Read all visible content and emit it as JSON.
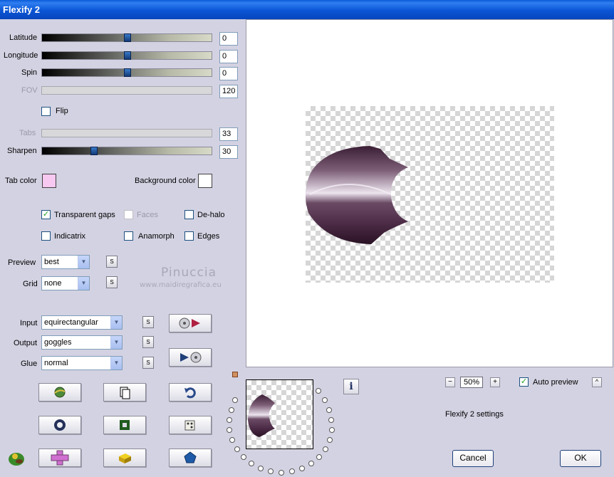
{
  "window": {
    "title": "Flexify 2"
  },
  "sliders": [
    {
      "label": "Latitude",
      "value": "0",
      "enabled": true
    },
    {
      "label": "Longitude",
      "value": "0",
      "enabled": true
    },
    {
      "label": "Spin",
      "value": "0",
      "enabled": true
    },
    {
      "label": "FOV",
      "value": "120",
      "enabled": false
    },
    {
      "label": "Tabs",
      "value": "33",
      "enabled": false
    },
    {
      "label": "Sharpen",
      "value": "30",
      "enabled": true
    }
  ],
  "flip": {
    "label": "Flip",
    "checked": false
  },
  "colors": {
    "tab_label": "Tab color",
    "tab": "#f7c8f0",
    "bg_label": "Background color",
    "bg": "#ffffff"
  },
  "options": {
    "transparent_gaps": {
      "label": "Transparent gaps",
      "checked": true
    },
    "faces": {
      "label": "Faces",
      "checked": false
    },
    "dehalo": {
      "label": "De-halo",
      "checked": false
    },
    "indicatrix": {
      "label": "Indicatrix",
      "checked": false
    },
    "anamorph": {
      "label": "Anamorph",
      "checked": false
    },
    "edges": {
      "label": "Edges",
      "checked": false
    }
  },
  "preview_select": {
    "label": "Preview",
    "value": "best"
  },
  "grid_select": {
    "label": "Grid",
    "value": "none"
  },
  "input_select": {
    "label": "Input",
    "value": "equirectangular"
  },
  "output_select": {
    "label": "Output",
    "value": "goggles"
  },
  "glue_select": {
    "label": "Glue",
    "value": "normal"
  },
  "s_button": "S",
  "watermark": {
    "name": "Pinuccia",
    "url": "www.maidiregrafica.eu"
  },
  "zoom": {
    "minus": "−",
    "value": "50%",
    "plus": "+"
  },
  "auto_preview": {
    "label": "Auto preview",
    "checked": true,
    "toggle": "^"
  },
  "settings_text": "Flexify 2 settings",
  "info_icon": "i",
  "buttons": {
    "cancel": "Cancel",
    "ok": "OK"
  }
}
